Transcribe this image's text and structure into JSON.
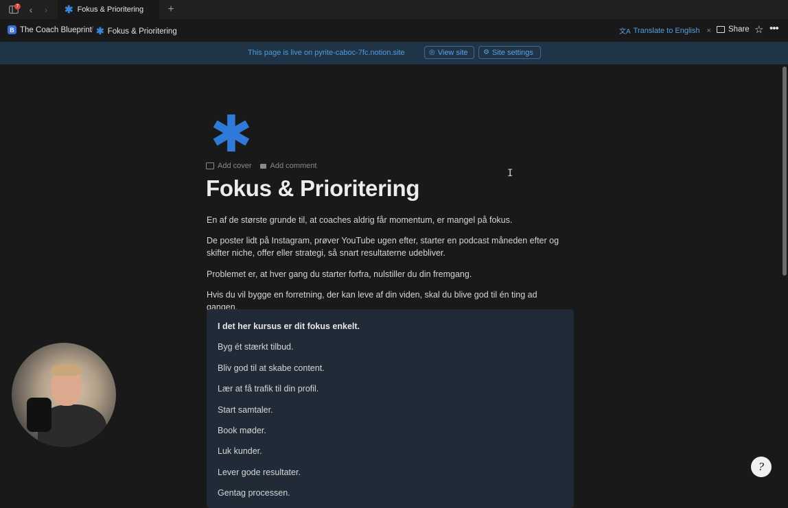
{
  "tabbar": {
    "sidebar_badge": "7",
    "tab_label": "Fokus & Prioritering",
    "new_tab_glyph": "+",
    "back_glyph": "‹",
    "forward_glyph": "›"
  },
  "topbar": {
    "workspace_name": "The Coach Blueprint",
    "workspace_icon_letter": "B",
    "separator": "/",
    "page_name": "Fokus & Prioritering",
    "translate_label": "Translate to English",
    "translate_close": "×",
    "share_label": "Share",
    "favorite_glyph": "☆",
    "more_glyph": "•••"
  },
  "banner": {
    "text": "This page is live on pyrite-caboc-7fc.notion.site",
    "view_site_label": "View site",
    "site_settings_label": "Site settings"
  },
  "page": {
    "icon_glyph": "✱",
    "add_cover_label": "Add cover",
    "add_comment_label": "Add comment",
    "title": "Fokus & Prioritering",
    "paragraphs": [
      "En af de største grunde til, at coaches aldrig får momentum, er mangel på fokus.",
      "De poster lidt på Instagram, prøver YouTube ugen efter, starter en podcast måneden efter og skifter niche, offer eller strategi, så snart resultaterne udebliver.",
      "Problemet er, at hver gang du starter forfra, nulstiller du din fremgang.",
      "Hvis du vil bygge en forretning, der kan leve af din viden, skal du blive god til én ting ad gangen."
    ],
    "callout": {
      "heading": "I det her kursus er dit fokus enkelt.",
      "lines": [
        "Byg ét stærkt tilbud.",
        "Bliv god til at skabe content.",
        "Lær at få trafik til din profil.",
        "Start samtaler.",
        "Book møder.",
        "Luk kunder.",
        "Lever gode resultater.",
        "Gentag processen."
      ]
    }
  },
  "colors": {
    "background": "#191919",
    "accent_blue": "#2f7ad8",
    "banner_bg": "#1f3447",
    "callout_bg": "#212b37"
  },
  "icons": {
    "sidebar": "sidebar-toggle-icon",
    "page": "asterisk-icon",
    "translate": "translate-icon",
    "view_site": "globe-icon",
    "site_settings": "gear-icon",
    "help": "help-icon"
  }
}
